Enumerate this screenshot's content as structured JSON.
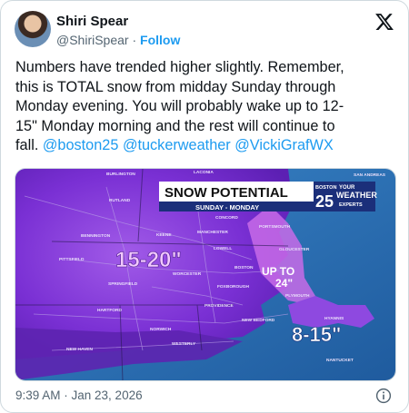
{
  "author": {
    "name": "Shiri Spear",
    "handle": "@ShiriSpear",
    "separator": "·",
    "follow_label": "Follow"
  },
  "tweet": {
    "text_lines": [
      "Numbers have trended higher slightly. Remember,",
      "this is TOTAL snow from midday Sunday through",
      "Monday evening.  You will probably wake up to 12-",
      "15\" Monday morning and the rest will continue to"
    ],
    "last_line_prefix": "fall.",
    "mentions": [
      "@boston25",
      "@tuckerweather",
      "@VickiGrafWX"
    ]
  },
  "map": {
    "title": "SNOW POTENTIAL",
    "subtitle": "SUNDAY - MONDAY",
    "logo_boston": "BOSTON",
    "logo_num": "25",
    "logo_your": "YOUR",
    "logo_weather": "WEATHER",
    "logo_experts": "EXPERTS",
    "zone_main": "15-20\"",
    "zone_up_line1": "UP TO",
    "zone_up_line2": "24\"",
    "zone_cape": "8-15\"",
    "towns": [
      "BURLINGTON",
      "LACONIA",
      "RUTLAND",
      "CONCORD",
      "PORTSMOUTH",
      "MANCHESTER",
      "KEENE",
      "BENNINGTON",
      "LOWELL",
      "GLOUCESTER",
      "PITTSFIELD",
      "WORCESTER",
      "BOSTON",
      "SPRINGFIELD",
      "FOXBOROUGH",
      "PLYMOUTH",
      "HARTFORD",
      "PROVIDENCE",
      "NEW BEDFORD",
      "HYANNIS",
      "NORWICH",
      "WESTERLY",
      "NEW HAVEN",
      "NANTUCKET",
      "SAN ANDREAS"
    ]
  },
  "footer": {
    "timestamp": "9:39 AM · Jan 23, 2026"
  },
  "colors": {
    "accent": "#1d9bf0",
    "snow_purple": "#7a2fd6",
    "ocean": "#2a6fb5"
  }
}
